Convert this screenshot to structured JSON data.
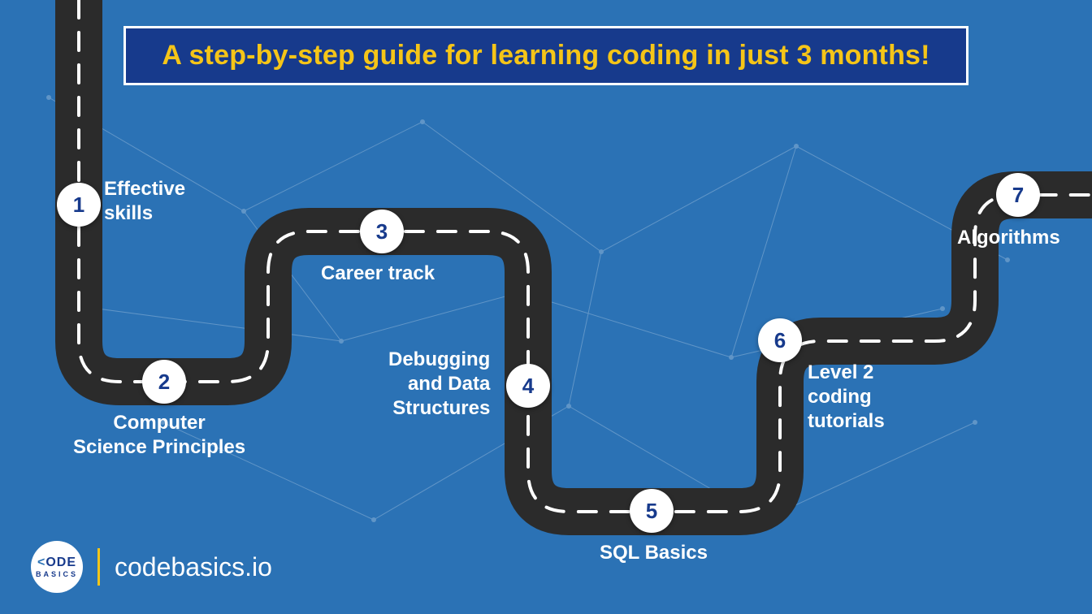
{
  "title": "A step-by-step guide for learning coding in just 3 months!",
  "steps": [
    {
      "num": "1",
      "label": "Effective\nskills"
    },
    {
      "num": "2",
      "label": "Computer\nScience Principles"
    },
    {
      "num": "3",
      "label": "Career track"
    },
    {
      "num": "4",
      "label": "Debugging\nand Data\nStructures"
    },
    {
      "num": "5",
      "label": "SQL Basics"
    },
    {
      "num": "6",
      "label": "Level 2\ncoding\ntutorials"
    },
    {
      "num": "7",
      "label": "Algorithms"
    }
  ],
  "brand": {
    "logo_top": "ODE",
    "logo_lt": "<",
    "logo_bot": "BASICS",
    "url": "codebasics.io"
  },
  "colors": {
    "bg": "#2b72b5",
    "banner_bg": "#173a8c",
    "accent_yellow": "#f5c518",
    "road": "#2b2b2b"
  }
}
